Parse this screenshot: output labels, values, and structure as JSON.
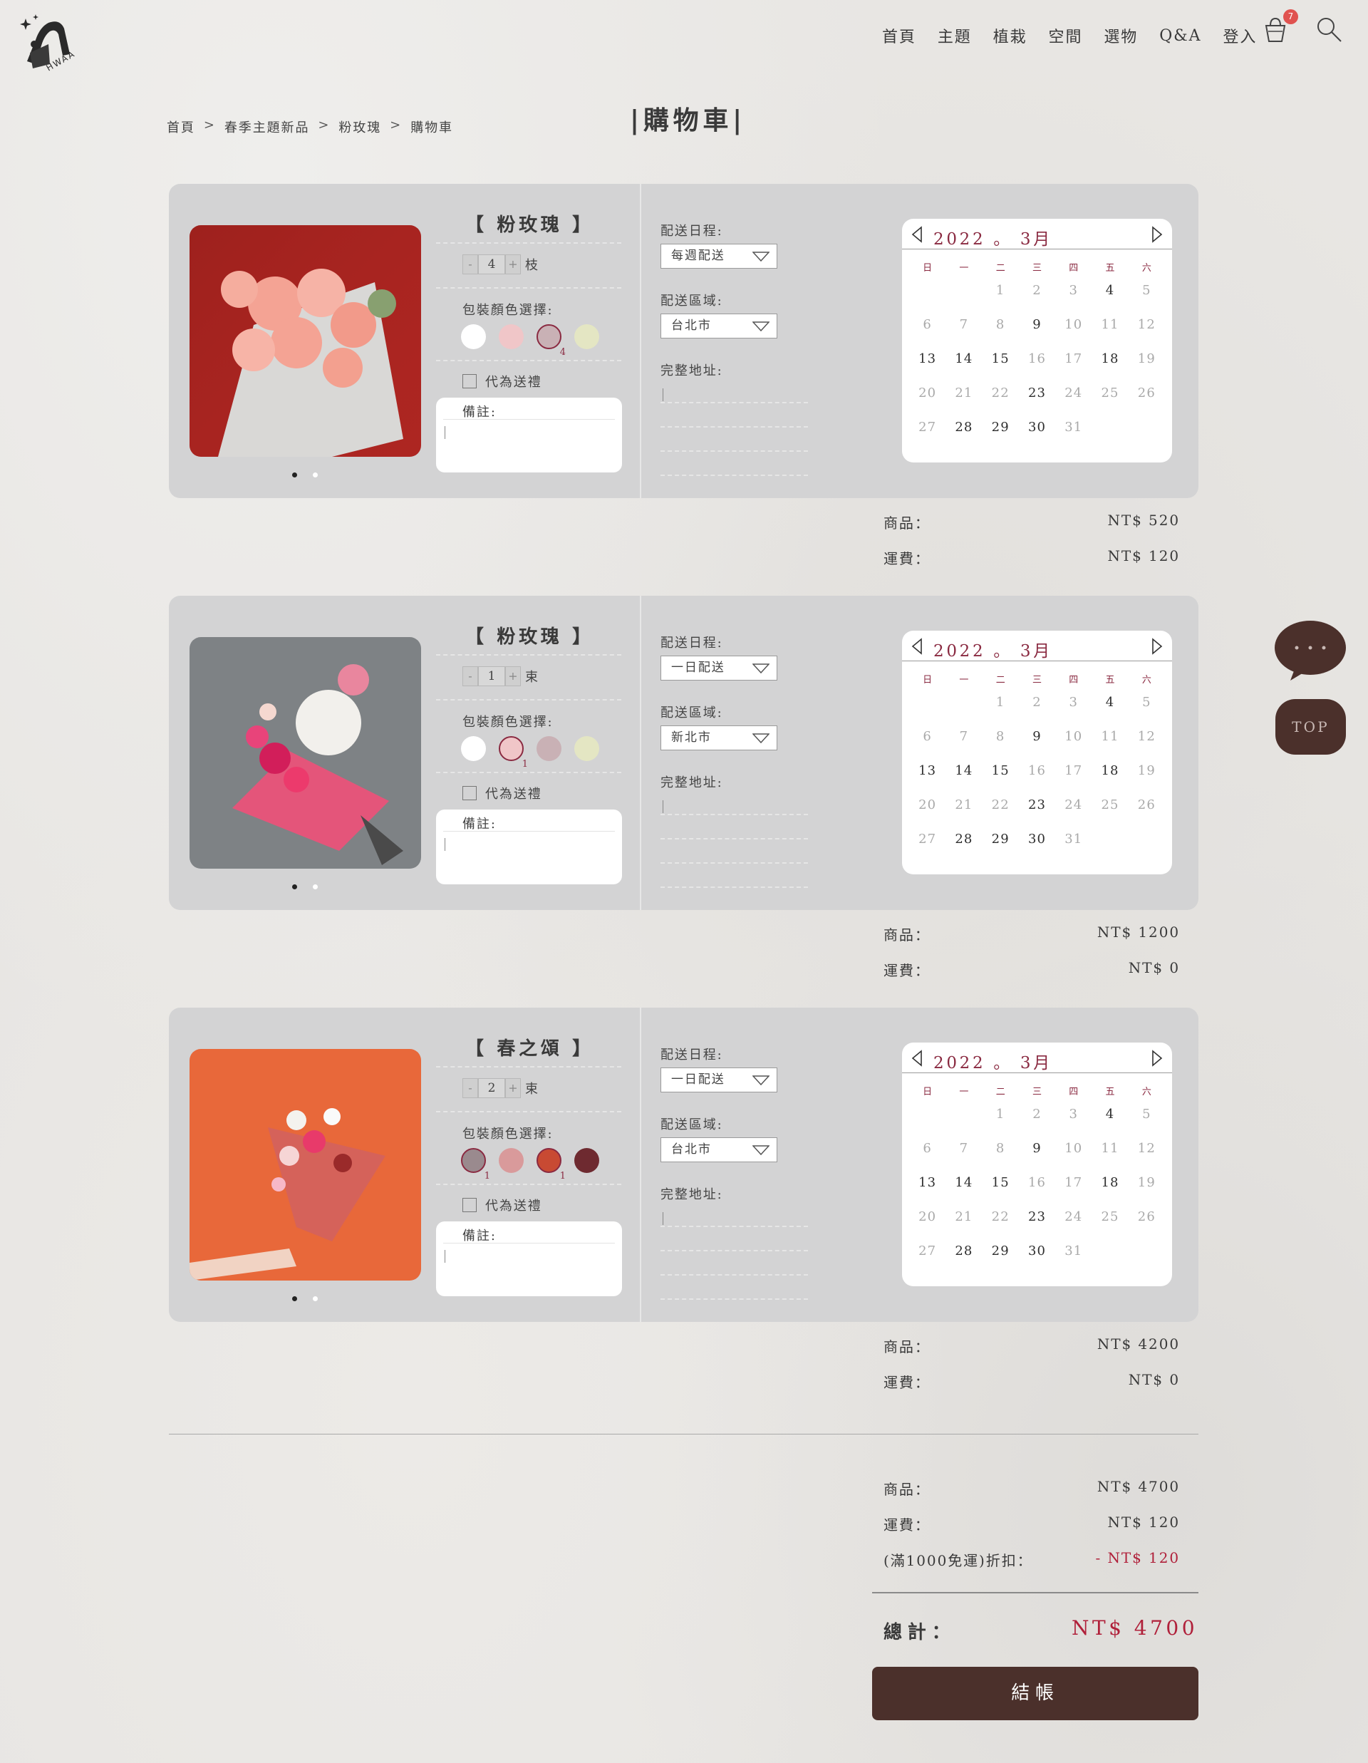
{
  "brand": {
    "logo_text": "HWAA"
  },
  "nav": {
    "items": [
      "首頁",
      "主題",
      "植栽",
      "空間",
      "選物",
      "Q&A",
      "登入"
    ],
    "cart_count": "7"
  },
  "breadcrumb": {
    "items": [
      "首頁",
      "春季主題新品",
      "粉玫瑰",
      "購物車"
    ],
    "separator": ">"
  },
  "page_title": "|購物車|",
  "labels": {
    "wrap_color": "包裝顏色選擇:",
    "gift": "代為送禮",
    "note": "備註:",
    "schedule": "配送日程:",
    "area": "配送區域:",
    "address": "完整地址:",
    "goods": "商品：",
    "shipping": "運費：",
    "discount": "(滿1000免運)折扣：",
    "total": "總計：",
    "qty_minus": "-",
    "qty_plus": "+"
  },
  "calendar": {
    "title": "2022 。 3月",
    "weekdays": [
      "日",
      "一",
      "二",
      "三",
      "四",
      "五",
      "六"
    ],
    "leading_blanks": 2,
    "days": [
      1,
      2,
      3,
      4,
      5,
      6,
      7,
      8,
      9,
      10,
      11,
      12,
      13,
      14,
      15,
      16,
      17,
      18,
      19,
      20,
      21,
      22,
      23,
      24,
      25,
      26,
      27,
      28,
      29,
      30,
      31
    ],
    "available_days": [
      4,
      9,
      13,
      14,
      15,
      18,
      23,
      28,
      29,
      30
    ]
  },
  "items": [
    {
      "name": "【 粉玫瑰 】",
      "qty": "4",
      "unit": "枝",
      "swatches": [
        {
          "color": "#ffffff",
          "selected": false,
          "count": ""
        },
        {
          "color": "#f0c6c8",
          "selected": false,
          "count": ""
        },
        {
          "color": "#c9b1b5",
          "selected": true,
          "count": "4"
        },
        {
          "color": "#e4e6c3",
          "selected": false,
          "count": ""
        }
      ],
      "schedule": "每週配送",
      "area": "台北市",
      "goods_price": "NT$ 520",
      "shipping_price": "NT$ 120"
    },
    {
      "name": "【 粉玫瑰 】",
      "qty": "1",
      "unit": "束",
      "swatches": [
        {
          "color": "#ffffff",
          "selected": false,
          "count": ""
        },
        {
          "color": "#f0c6c8",
          "selected": true,
          "count": "1"
        },
        {
          "color": "#c9b1b5",
          "selected": false,
          "count": ""
        },
        {
          "color": "#e4e6c3",
          "selected": false,
          "count": ""
        }
      ],
      "schedule": "一日配送",
      "area": "新北市",
      "goods_price": "NT$ 1200",
      "shipping_price": "NT$ 0"
    },
    {
      "name": "【 春之頌 】",
      "qty": "2",
      "unit": "束",
      "swatches": [
        {
          "color": "#9a8a8e",
          "selected": true,
          "count": "1"
        },
        {
          "color": "#d99a9b",
          "selected": false,
          "count": ""
        },
        {
          "color": "#c84a33",
          "selected": true,
          "count": "1"
        },
        {
          "color": "#6e2a30",
          "selected": false,
          "count": ""
        }
      ],
      "schedule": "一日配送",
      "area": "台北市",
      "goods_price": "NT$ 4200",
      "shipping_price": "NT$ 0"
    }
  ],
  "summary": {
    "goods": "NT$ 4700",
    "shipping": "NT$ 120",
    "discount": "- NT$ 120",
    "total": "NT$ 4700"
  },
  "checkout_label": "結帳",
  "top_label": "TOP",
  "colors": {
    "accent": "#8a2a41",
    "brand_dark": "#4b302b",
    "price_red": "#b0203a"
  }
}
